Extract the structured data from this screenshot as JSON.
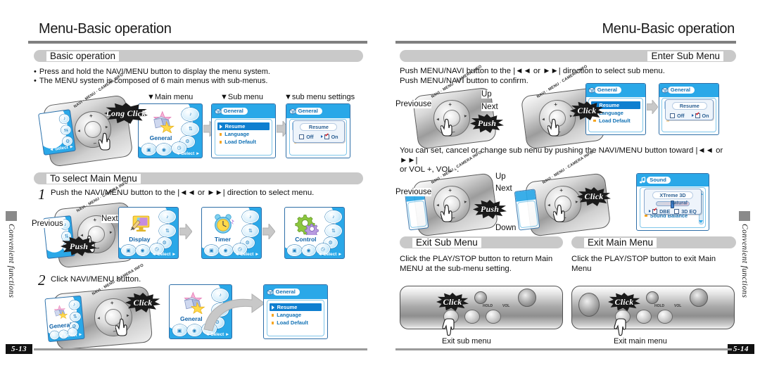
{
  "document": {
    "title": "Menu-Basic operation",
    "side_tab_label": "Convenient functions"
  },
  "left_page": {
    "title": "Menu-Basic operation",
    "page_number": "5-13",
    "side_tab_label": "Convenient functions",
    "sections": [
      {
        "id": "basic-operation",
        "label": "Basic operation"
      },
      {
        "id": "to-select-main-menu",
        "label": "To select Main Menu"
      }
    ],
    "bullets": [
      "Press and hold the NAVI/MENU button to display the menu system.",
      "The MENU system is composed of 6 main menus with sub-menus."
    ],
    "flow_captions": [
      "▼Main menu",
      "▼Sub menu",
      "▼sub menu settings"
    ],
    "device_callouts": {
      "long_click": "Long Click",
      "push": "Push",
      "click": "Click",
      "previous": "Previous",
      "next": "Next"
    },
    "device_labels": {
      "navi_menu": "NAVI · MENU · CAMERA INFO",
      "plus": "+",
      "minus": "–",
      "rew": "◄◄",
      "ff": "►►"
    },
    "steps": [
      {
        "number": "1",
        "text": "Push the NAVI/MENU button to the |◄◄ or ►►| direction to select menu."
      },
      {
        "number": "2",
        "text": "Click NAVI/MENU button."
      }
    ],
    "screens": {
      "main_menu_general": {
        "type": "main",
        "label": "General",
        "icon": "gift-box-stars-icon",
        "select_hint": "◄ Select ►",
        "ring_icons": [
          "music-note-icon",
          "repeat-icon",
          "gear-icon",
          "box-icon",
          "record-icon",
          "clock-icon"
        ]
      },
      "sub_menu_general": {
        "type": "sub",
        "title": "General",
        "items": [
          {
            "label": "Resume",
            "selected": true
          },
          {
            "label": "Language",
            "selected": false
          },
          {
            "label": "Load Default",
            "selected": false
          }
        ]
      },
      "sub_menu_settings_general": {
        "type": "sub-settings",
        "title": "General",
        "popup_title": "Resume",
        "options": [
          {
            "label": "Off",
            "checked": false
          },
          {
            "label": "On",
            "checked": true
          }
        ]
      },
      "main_menu_display": {
        "type": "main",
        "label": "Display",
        "icon": "monitor-brush-icon",
        "select_hint": "◄ Select ►"
      },
      "main_menu_timer": {
        "type": "main",
        "label": "Timer",
        "icon": "alarm-clock-icon",
        "select_hint": "◄ Select ►"
      },
      "main_menu_control": {
        "type": "main",
        "label": "Control",
        "icon": "gears-icon",
        "select_hint": "◄ Select ►"
      }
    }
  },
  "right_page": {
    "title": "Menu-Basic operation",
    "page_number": "5-14",
    "side_tab_label": "Convenient functions",
    "sections": [
      {
        "id": "enter-sub-menu",
        "label": "Enter Sub Menu"
      },
      {
        "id": "exit-sub-menu",
        "label": "Exit Sub Menu"
      },
      {
        "id": "exit-main-menu",
        "label": "Exit Main Menu"
      }
    ],
    "intro_text": "Push MENU/NAVI button to the |◄◄ or ►►| direction to select sub menu.\nPush MENU/NAVI button to confirm.",
    "middle_text": "You can set, cancel or change sub nenu by pushing the NAVI/MENU button toward |◄◄ or ►►|\nor VOL +, VOL -.",
    "exit_sub_text": "Click the PLAY/STOP button to return Main\nMENU at the sub-menu setting.",
    "exit_main_text": "Click the PLAY/STOP button to exit Main\nMenu",
    "device_callouts": {
      "previouse": "Previouse",
      "next": "Next",
      "up": "Up",
      "down": "Down",
      "push": "Push",
      "click": "Click"
    },
    "bottom_labels": {
      "exit_sub": "Exit sub menu",
      "exit_main": "Exit main menu"
    },
    "device_labels": {
      "navi_menu": "NAVI · MENU · CAMERA INFO",
      "hold": "HOLD",
      "vol": "VOL"
    },
    "screens": {
      "sub_menu_general": {
        "type": "sub",
        "title": "General",
        "items": [
          {
            "label": "Resume",
            "selected": true
          },
          {
            "label": "Language",
            "selected": false
          },
          {
            "label": "Load Default",
            "selected": false
          }
        ]
      },
      "sub_menu_settings_general": {
        "type": "sub-settings",
        "title": "General",
        "popup_title": "Resume",
        "options": [
          {
            "label": "Off",
            "checked": false
          },
          {
            "label": "On",
            "checked": true
          }
        ]
      },
      "sound_menu": {
        "type": "sub-settings",
        "title": "Sound",
        "popup_title": "XTreme 3D",
        "slider_label": "Natural",
        "options": [
          {
            "label": "DBE",
            "checked": true
          },
          {
            "label": "3D EQ",
            "checked": false
          }
        ],
        "list_item": "Sound Balance"
      },
      "partial_sound_menu": {
        "type": "sub-settings",
        "title": "Sound",
        "popup_title": "XTreme 3D",
        "options": [
          {
            "label": "DBE",
            "checked": true
          },
          {
            "label": "3D EQ",
            "checked": false
          }
        ]
      }
    }
  },
  "colors": {
    "lcd_blue": "#2aa8e8",
    "lcd_select": "#0f7fd0",
    "header_gray": "#c9c9c9",
    "rule_gray": "#808080",
    "accent_orange": "#f5a623",
    "check_red": "#e0242b"
  }
}
